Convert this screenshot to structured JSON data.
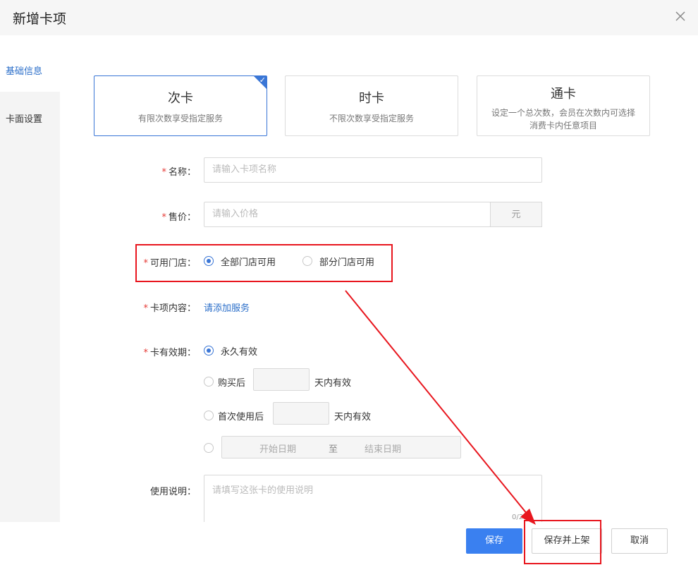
{
  "dialog": {
    "title": "新增卡项"
  },
  "sidebar": {
    "items": [
      {
        "label": "基础信息"
      },
      {
        "label": "卡面设置"
      }
    ]
  },
  "card_types": [
    {
      "title": "次卡",
      "desc": "有限次数享受指定服务",
      "selected": true
    },
    {
      "title": "时卡",
      "desc": "不限次数享受指定服务",
      "selected": false
    },
    {
      "title": "通卡",
      "desc": "设定一个总次数，会员在次数内可选择消费卡内任意项目",
      "selected": false
    }
  ],
  "form": {
    "name": {
      "label": "名称：",
      "placeholder": "请输入卡项名称"
    },
    "price": {
      "label": "售价：",
      "placeholder": "请输入价格",
      "unit": "元"
    },
    "stores": {
      "label": "可用门店：",
      "options": [
        "全部门店可用",
        "部分门店可用"
      ],
      "selected": "全部门店可用"
    },
    "content": {
      "label": "卡项内容：",
      "link": "请添加服务"
    },
    "validity": {
      "label": "卡有效期：",
      "permanent": "永久有效",
      "after_purchase": "购买后",
      "after_first_use": "首次使用后",
      "days_suffix": "天内有效",
      "start_placeholder": "开始日期",
      "range_sep": "至",
      "end_placeholder": "结束日期"
    },
    "notes": {
      "label": "使用说明：",
      "placeholder": "请填写这张卡的使用说明",
      "counter": "0/200"
    }
  },
  "footer": {
    "save": "保存",
    "save_publish": "保存并上架",
    "cancel": "取消"
  },
  "colors": {
    "accent": "#3a80f0",
    "annotation": "#e8161e"
  }
}
